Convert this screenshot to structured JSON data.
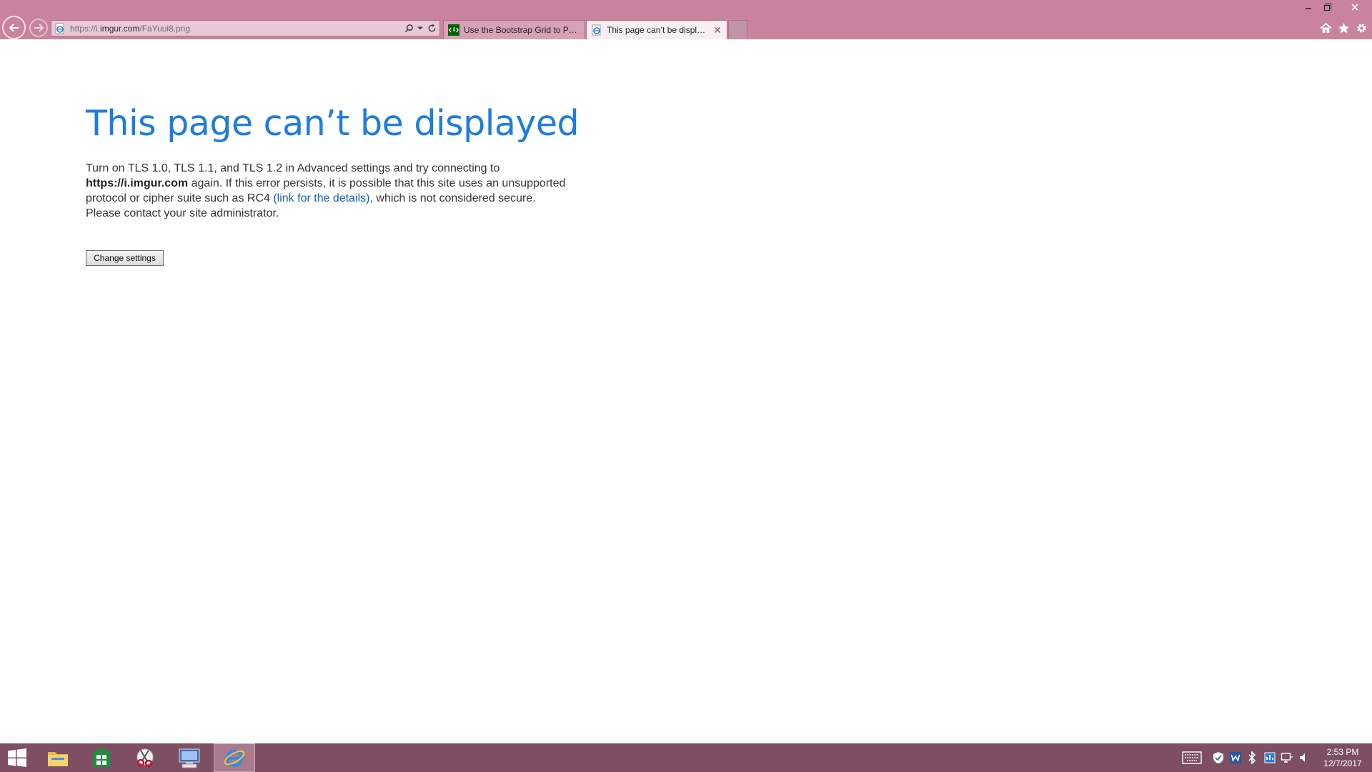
{
  "browser": {
    "address_bar": {
      "url_prefix": "https://i.",
      "url_domain": "imgur.com",
      "url_path": "/FaYuui8.png"
    },
    "tabs": [
      {
        "title": "Use the Bootstrap Grid to Put E...",
        "active": false
      },
      {
        "title": "This page can’t be displayed",
        "active": true,
        "close_glyph": "✕"
      }
    ],
    "icons": {
      "back": "back-arrow-icon",
      "forward": "forward-arrow-icon",
      "search": "search-icon",
      "dropdown": "chevron-down-icon",
      "refresh": "refresh-icon",
      "home": "home-icon",
      "favorites": "star-icon",
      "tools": "gear-icon"
    },
    "window_controls": [
      "minimize-icon",
      "restore-icon",
      "close-icon"
    ],
    "colors": {
      "chrome": "#c8849c",
      "active_tab": "#f8eef2",
      "inactive_tab": "#d7a2b6"
    }
  },
  "page": {
    "heading": "This page can’t be displayed",
    "paragraph": {
      "part1": "Turn on TLS 1.0, TLS 1.1, and TLS 1.2 in Advanced settings and try connecting to ",
      "site": "https://i.imgur.com",
      "part2": " again. If this error persists, it is possible that this site uses an unsupported protocol or cipher suite such as RC4 ",
      "link": "(link for the details)",
      "part3": ", which is not considered secure. Please contact your site administrator."
    },
    "button_label": "Change settings",
    "colors": {
      "heading": "#1e7ce0",
      "link": "#1461b8"
    }
  },
  "taskbar": {
    "apps": [
      "start-icon",
      "file-explorer-icon",
      "store-icon",
      "snipping-tool-icon",
      "remote-desktop-icon",
      "internet-explorer-icon"
    ],
    "tray": [
      "keyboard-icon",
      "defender-icon",
      "w-app-icon",
      "bluetooth-icon",
      "network-icon",
      "monitor-icon",
      "volume-icon"
    ],
    "clock": {
      "time": "2:53 PM",
      "date": "12/7/2017"
    },
    "color": "#7e4f62"
  }
}
